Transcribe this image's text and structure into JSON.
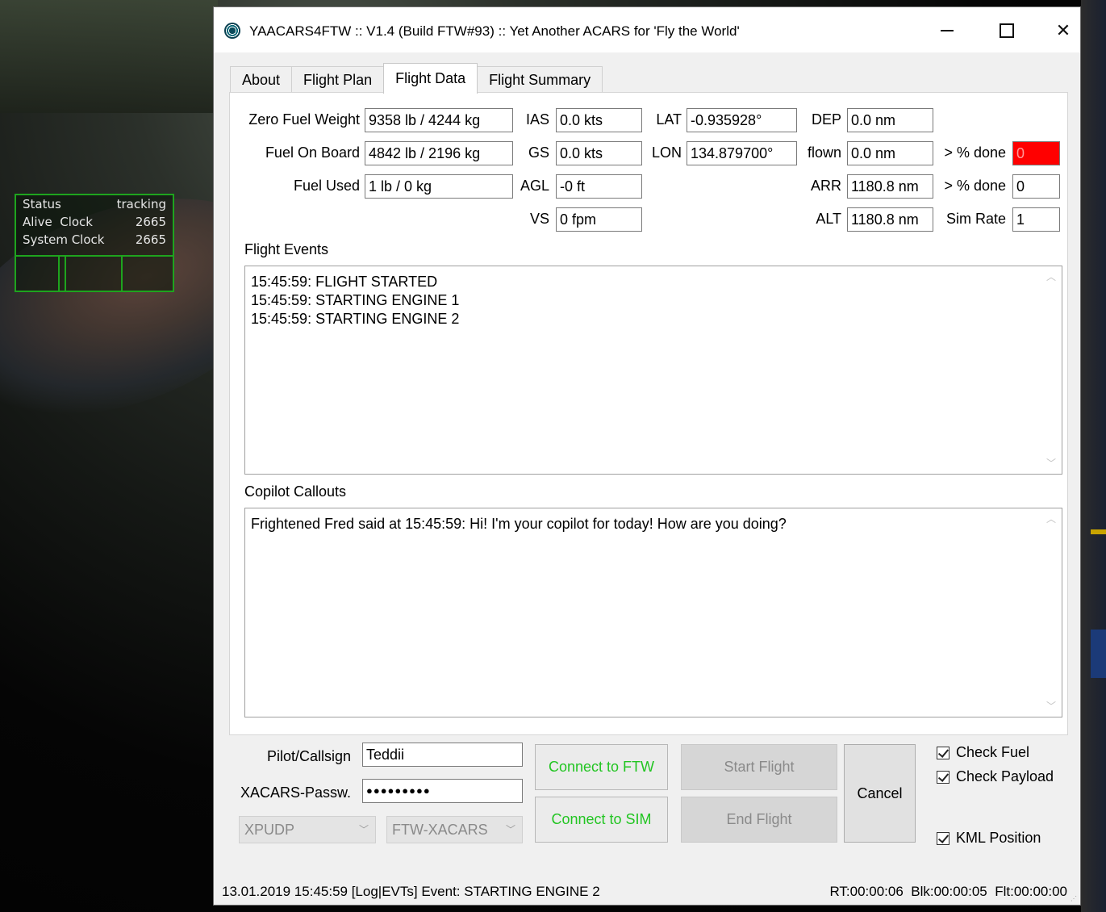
{
  "overlay": {
    "rows": [
      {
        "label": "Status",
        "value": "tracking"
      },
      {
        "label": "Alive  Clock",
        "value": "2665"
      },
      {
        "label": "System Clock",
        "value": "2665"
      }
    ],
    "color": "#1ea41e"
  },
  "window": {
    "title": "YAACARS4FTW :: V1.4 (Build FTW#93) :: Yet Another ACARS for 'Fly the World'",
    "minimize_icon": "minimize-icon",
    "maximize_icon": "maximize-icon",
    "close_icon": "close-icon",
    "close_glyph": "✕"
  },
  "tabs": [
    "About",
    "Flight Plan",
    "Flight Data",
    "Flight Summary"
  ],
  "active_tab": "Flight Data",
  "flight_data": {
    "zfw_label": "Zero Fuel Weight",
    "zfw": "9358 lb / 4244 kg",
    "fob_label": "Fuel On Board",
    "fob": "4842 lb / 2196 kg",
    "used_label": "Fuel Used",
    "used": "1 lb / 0 kg",
    "ias_label": "IAS",
    "ias": "0.0 kts",
    "gs_label": "GS",
    "gs": "0.0 kts",
    "agl_label": "AGL",
    "agl": "-0 ft",
    "vs_label": "VS",
    "vs": "0 fpm",
    "lat_label": "LAT",
    "lat": "-0.935928°",
    "lon_label": "LON",
    "lon": "134.879700°",
    "dep_label": "DEP",
    "dep": "0.0 nm",
    "flown_label": "flown",
    "flown": "0.0 nm",
    "arr_label": "ARR",
    "arr": "1180.8 nm",
    "alt_label": "ALT",
    "alt": "1180.8 nm",
    "pct_done_label_1": "> % done",
    "pct_done_1": "0",
    "pct_done_label_2": "> % done",
    "pct_done_2": "0",
    "sim_rate_label": "Sim Rate",
    "sim_rate": "1",
    "alert_color": "#ff0000"
  },
  "flight_events": {
    "label": "Flight Events",
    "lines": [
      "15:45:59: FLIGHT STARTED",
      "15:45:59: STARTING ENGINE 1",
      "15:45:59: STARTING ENGINE 2"
    ]
  },
  "copilot": {
    "label": "Copilot Callouts",
    "lines": [
      "Frightened Fred said at 15:45:59: Hi! I'm your copilot for today! How are you doing?"
    ]
  },
  "controls": {
    "pilot_label": "Pilot/Callsign",
    "pilot_value": "Teddii",
    "pass_label": "XACARS-Passw.",
    "pass_value": "●●●●●●●●●",
    "combo_sim": "XPUDP",
    "combo_ftw": "FTW-XACARS",
    "connect_ftw": "Connect to FTW",
    "connect_sim": "Connect to SIM",
    "start_flight": "Start Flight",
    "end_flight": "End Flight",
    "cancel": "Cancel",
    "check_fuel": "Check Fuel",
    "check_payload": "Check Payload",
    "kml_position": "KML Position",
    "connect_color": "#22c522"
  },
  "status_bar": {
    "left": "13.01.2019 15:45:59 [Log|EVTs] Event: STARTING ENGINE 2",
    "right": "RT:00:00:06  Blk:00:00:05  Flt:00:00:00"
  }
}
